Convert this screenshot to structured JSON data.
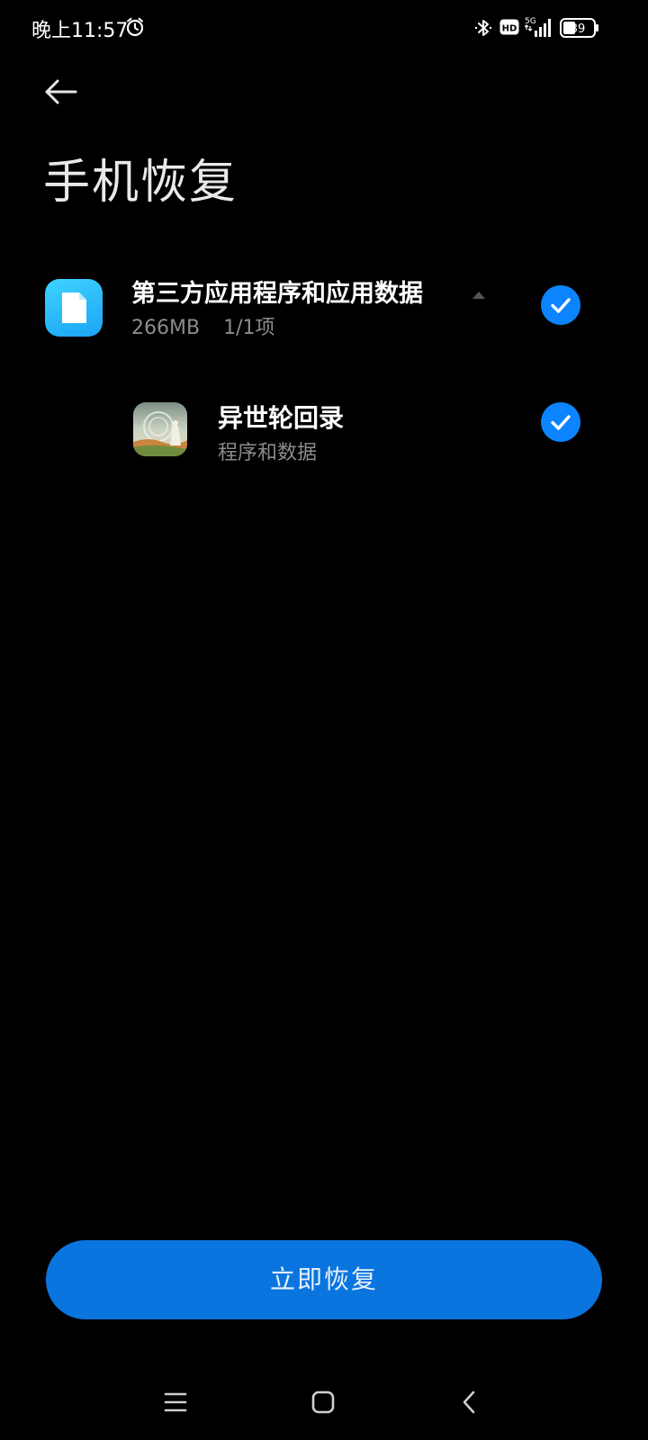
{
  "status_bar": {
    "time": "晚上11:57",
    "network": "5G",
    "hd": "HD",
    "battery": "39"
  },
  "header": {
    "title": "手机恢复"
  },
  "group": {
    "title": "第三方应用程序和应用数据",
    "size": "266MB",
    "count": "1/1项",
    "checked": true
  },
  "apps": [
    {
      "title": "异世轮回录",
      "subtitle": "程序和数据",
      "checked": true
    }
  ],
  "actions": {
    "restore_label": "立即恢复"
  },
  "colors": {
    "accent": "#0d84ff",
    "button": "#0b75df",
    "background": "#000000",
    "secondary_text": "#8c8c8c"
  }
}
